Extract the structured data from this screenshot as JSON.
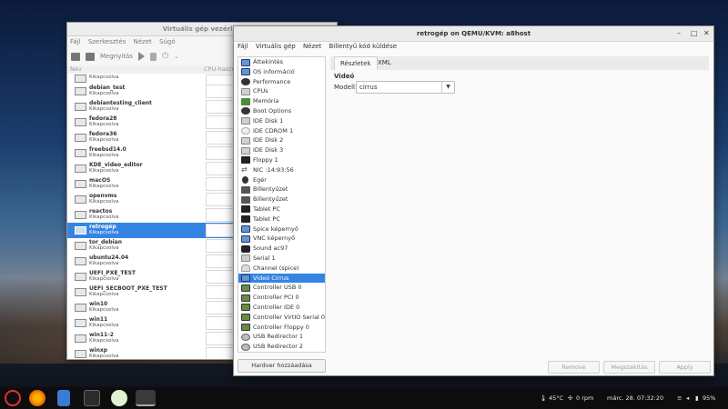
{
  "manager": {
    "title": "Virtuális gép vezérlőp",
    "menu": [
      "Fájl",
      "Szerkesztés",
      "Nézet",
      "Súgó"
    ],
    "open_label": "Megnyitás",
    "col_name": "Név",
    "col_cpu": "CPU-haszn",
    "vms": [
      {
        "name": "",
        "status": "Kikapcsolva"
      },
      {
        "name": "debian_test",
        "status": "Kikapcsolva"
      },
      {
        "name": "debiantesting_client",
        "status": "Kikapcsolva"
      },
      {
        "name": "fedora28",
        "status": "Kikapcsolva"
      },
      {
        "name": "fedora36",
        "status": "Kikapcsolva"
      },
      {
        "name": "freebsd14.0",
        "status": "Kikapcsolva"
      },
      {
        "name": "KDE_video_editor",
        "status": "Kikapcsolva"
      },
      {
        "name": "macOS",
        "status": "Kikapcsolva"
      },
      {
        "name": "openvms",
        "status": "Kikapcsolva"
      },
      {
        "name": "reactos",
        "status": "Kikapcsolva"
      },
      {
        "name": "retrogép",
        "status": "Kikapcsolva"
      },
      {
        "name": "tor_debian",
        "status": "Kikapcsolva"
      },
      {
        "name": "ubuntu24.04",
        "status": "Kikapcsolva"
      },
      {
        "name": "UEFI_PXE_TEST",
        "status": "Kikapcsolva"
      },
      {
        "name": "UEFI_SECBOOT_PXE_TEST",
        "status": "Kikapcsolva"
      },
      {
        "name": "win10",
        "status": "Kikapcsolva"
      },
      {
        "name": "win11",
        "status": "Kikapcsolva"
      },
      {
        "name": "win11-2",
        "status": "Kikapcsolva"
      },
      {
        "name": "winxp",
        "status": "Kikapcsolva"
      }
    ],
    "selected_index": 10
  },
  "details": {
    "title": "retrogép on QEMU/KVM: a8host",
    "window_controls": [
      "–",
      "□",
      "✕"
    ],
    "menu": [
      "Fájl",
      "Virtuális gép",
      "Nézet",
      "Billentyű kód küldése"
    ],
    "hardware": [
      {
        "label": "Áttekintés",
        "icon": "mon"
      },
      {
        "label": "OS információ",
        "icon": "mon"
      },
      {
        "label": "Performance",
        "icon": "gear"
      },
      {
        "label": "CPUs",
        "icon": "disk"
      },
      {
        "label": "Memória",
        "icon": "ram"
      },
      {
        "label": "Boot Options",
        "icon": "gear"
      },
      {
        "label": "IDE Disk 1",
        "icon": "disk"
      },
      {
        "label": "IDE CDROM 1",
        "icon": "cd"
      },
      {
        "label": "IDE Disk 2",
        "icon": "disk"
      },
      {
        "label": "IDE Disk 3",
        "icon": "disk"
      },
      {
        "label": "Floppy 1",
        "icon": "floppy"
      },
      {
        "label": "NIC :14:93:56",
        "icon": "net"
      },
      {
        "label": "Egér",
        "icon": "mouse"
      },
      {
        "label": "Billentyűzet",
        "icon": "kbd"
      },
      {
        "label": "Billentyűzet",
        "icon": "kbd"
      },
      {
        "label": "Tablet PC",
        "icon": "tab"
      },
      {
        "label": "Tablet PC",
        "icon": "tab"
      },
      {
        "label": "Spice képernyő",
        "icon": "mon"
      },
      {
        "label": "VNC képernyő",
        "icon": "mon"
      },
      {
        "label": "Sound ac97",
        "icon": "snd"
      },
      {
        "label": "Serial 1",
        "icon": "ser"
      },
      {
        "label": "Channel (spice)",
        "icon": "chan"
      },
      {
        "label": "Videó Cirrus",
        "icon": "mon"
      },
      {
        "label": "Controller USB 0",
        "icon": "ctl"
      },
      {
        "label": "Controller PCI 0",
        "icon": "ctl"
      },
      {
        "label": "Controller IDE 0",
        "icon": "ctl"
      },
      {
        "label": "Controller VirtIO Serial 0",
        "icon": "ctl"
      },
      {
        "label": "Controller Floppy 0",
        "icon": "ctl"
      },
      {
        "label": "USB Redirector 1",
        "icon": "usb"
      },
      {
        "label": "USB Redirector 2",
        "icon": "usb"
      }
    ],
    "selected_hw": 22,
    "add_hw_label": "Hardver hozzáadása",
    "tabs": [
      "Részletek",
      "XML"
    ],
    "section_title": "Videó",
    "model_label": "Modell:",
    "model_value": "cirrus",
    "remove_label": "Remove",
    "cancel_label": "Megszakítás",
    "apply_label": "Apply"
  },
  "taskbar": {
    "temp": "45°C",
    "fan": "0 rpm",
    "datetime": "márc. 28. 07:32:20",
    "battery": "95%"
  },
  "colors": {
    "accent": "#3584e4"
  }
}
